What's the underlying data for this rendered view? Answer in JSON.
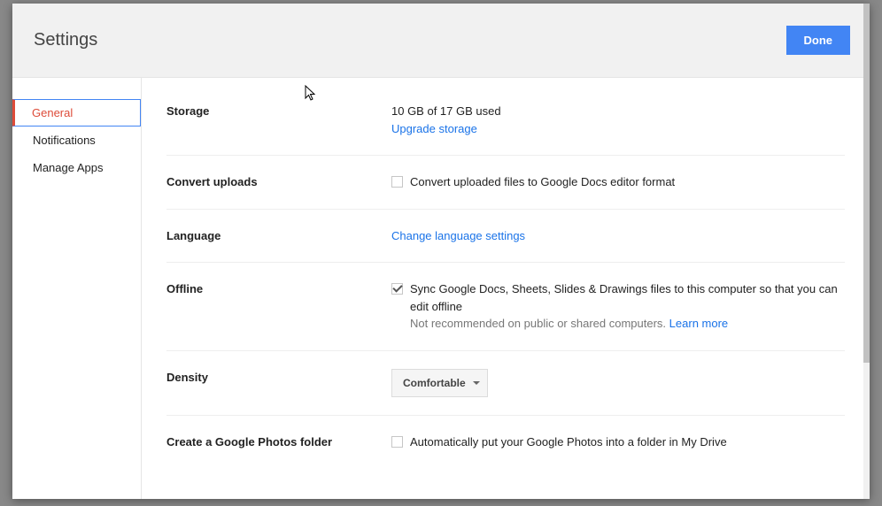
{
  "header": {
    "title": "Settings",
    "done": "Done"
  },
  "nav": {
    "general": "General",
    "notifications": "Notifications",
    "manage_apps": "Manage Apps"
  },
  "sections": {
    "storage": {
      "label": "Storage",
      "used": "10 GB of 17 GB used",
      "upgrade": "Upgrade storage"
    },
    "convert": {
      "label": "Convert uploads",
      "text": "Convert uploaded files to Google Docs editor format"
    },
    "language": {
      "label": "Language",
      "link": "Change language settings"
    },
    "offline": {
      "label": "Offline",
      "text": "Sync Google Docs, Sheets, Slides & Drawings files to this computer so that you can edit offline",
      "hint": "Not recommended on public or shared computers.",
      "learn": "Learn more"
    },
    "density": {
      "label": "Density",
      "value": "Comfortable"
    },
    "photos": {
      "label": "Create a Google Photos folder",
      "text": "Automatically put your Google Photos into a folder in My Drive"
    }
  }
}
